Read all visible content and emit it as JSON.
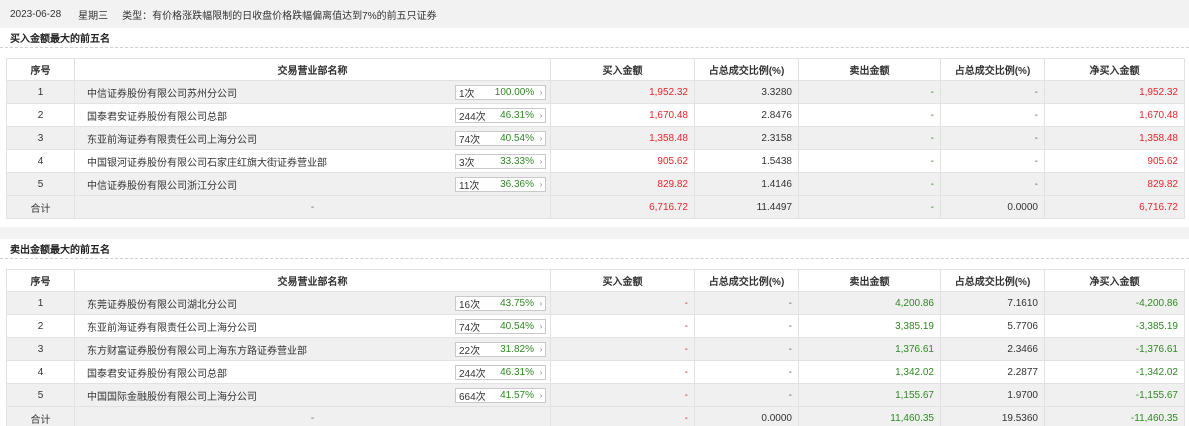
{
  "header": {
    "date": "2023-06-28",
    "weekday": "星期三",
    "type_label": "类型：",
    "type_text": "有价格涨跌幅限制的日收盘价格跌幅偏离值达到7%的前五只证券"
  },
  "columns": [
    "序号",
    "交易营业部名称",
    "买入金额",
    "占总成交比例(%)",
    "卖出金额",
    "占总成交比例(%)",
    "净买入金额"
  ],
  "buy_section": {
    "title": "买入金额最大的前五名",
    "rows": [
      {
        "idx": "1",
        "name": "中信证券股份有限公司苏州分公司",
        "times": "1次",
        "pct": "100.00%",
        "buy": "1,952.32",
        "buy_ratio": "3.3280",
        "sell": "-",
        "sell_ratio": "-",
        "net": "1,952.32"
      },
      {
        "idx": "2",
        "name": "国泰君安证券股份有限公司总部",
        "times": "244次",
        "pct": "46.31%",
        "buy": "1,670.48",
        "buy_ratio": "2.8476",
        "sell": "-",
        "sell_ratio": "-",
        "net": "1,670.48"
      },
      {
        "idx": "3",
        "name": "东亚前海证券有限责任公司上海分公司",
        "times": "74次",
        "pct": "40.54%",
        "buy": "1,358.48",
        "buy_ratio": "2.3158",
        "sell": "-",
        "sell_ratio": "-",
        "net": "1,358.48"
      },
      {
        "idx": "4",
        "name": "中国银河证券股份有限公司石家庄红旗大街证券营业部",
        "times": "3次",
        "pct": "33.33%",
        "buy": "905.62",
        "buy_ratio": "1.5438",
        "sell": "-",
        "sell_ratio": "-",
        "net": "905.62"
      },
      {
        "idx": "5",
        "name": "中信证券股份有限公司浙江分公司",
        "times": "11次",
        "pct": "36.36%",
        "buy": "829.82",
        "buy_ratio": "1.4146",
        "sell": "-",
        "sell_ratio": "-",
        "net": "829.82"
      }
    ],
    "total": {
      "label": "合计",
      "name": "-",
      "buy": "6,716.72",
      "buy_ratio": "11.4497",
      "sell": "-",
      "sell_ratio": "0.0000",
      "net": "6,716.72"
    }
  },
  "sell_section": {
    "title": "卖出金额最大的前五名",
    "rows": [
      {
        "idx": "1",
        "name": "东莞证券股份有限公司湖北分公司",
        "times": "16次",
        "pct": "43.75%",
        "buy": "-",
        "buy_ratio": "-",
        "sell": "4,200.86",
        "sell_ratio": "7.1610",
        "net": "-4,200.86"
      },
      {
        "idx": "2",
        "name": "东亚前海证券有限责任公司上海分公司",
        "times": "74次",
        "pct": "40.54%",
        "buy": "-",
        "buy_ratio": "-",
        "sell": "3,385.19",
        "sell_ratio": "5.7706",
        "net": "-3,385.19"
      },
      {
        "idx": "3",
        "name": "东方财富证券股份有限公司上海东方路证券营业部",
        "times": "22次",
        "pct": "31.82%",
        "buy": "-",
        "buy_ratio": "-",
        "sell": "1,376.61",
        "sell_ratio": "2.3466",
        "net": "-1,376.61"
      },
      {
        "idx": "4",
        "name": "国泰君安证券股份有限公司总部",
        "times": "244次",
        "pct": "46.31%",
        "buy": "-",
        "buy_ratio": "-",
        "sell": "1,342.02",
        "sell_ratio": "2.2877",
        "net": "-1,342.02"
      },
      {
        "idx": "5",
        "name": "中国国际金融股份有限公司上海分公司",
        "times": "664次",
        "pct": "41.57%",
        "buy": "-",
        "buy_ratio": "-",
        "sell": "1,155.67",
        "sell_ratio": "1.9700",
        "net": "-1,155.67"
      }
    ],
    "total": {
      "label": "合计",
      "name": "-",
      "buy": "-",
      "buy_ratio": "0.0000",
      "sell": "11,460.35",
      "sell_ratio": "19.5360",
      "net": "-11,460.35"
    }
  },
  "colors": {
    "positive": "#e8242c",
    "negative": "#2f8a23",
    "row_stripe": "#f0f0f0",
    "band": "#f2f2f2"
  },
  "icons": {
    "badge_arrow": "chevron-right-icon"
  }
}
